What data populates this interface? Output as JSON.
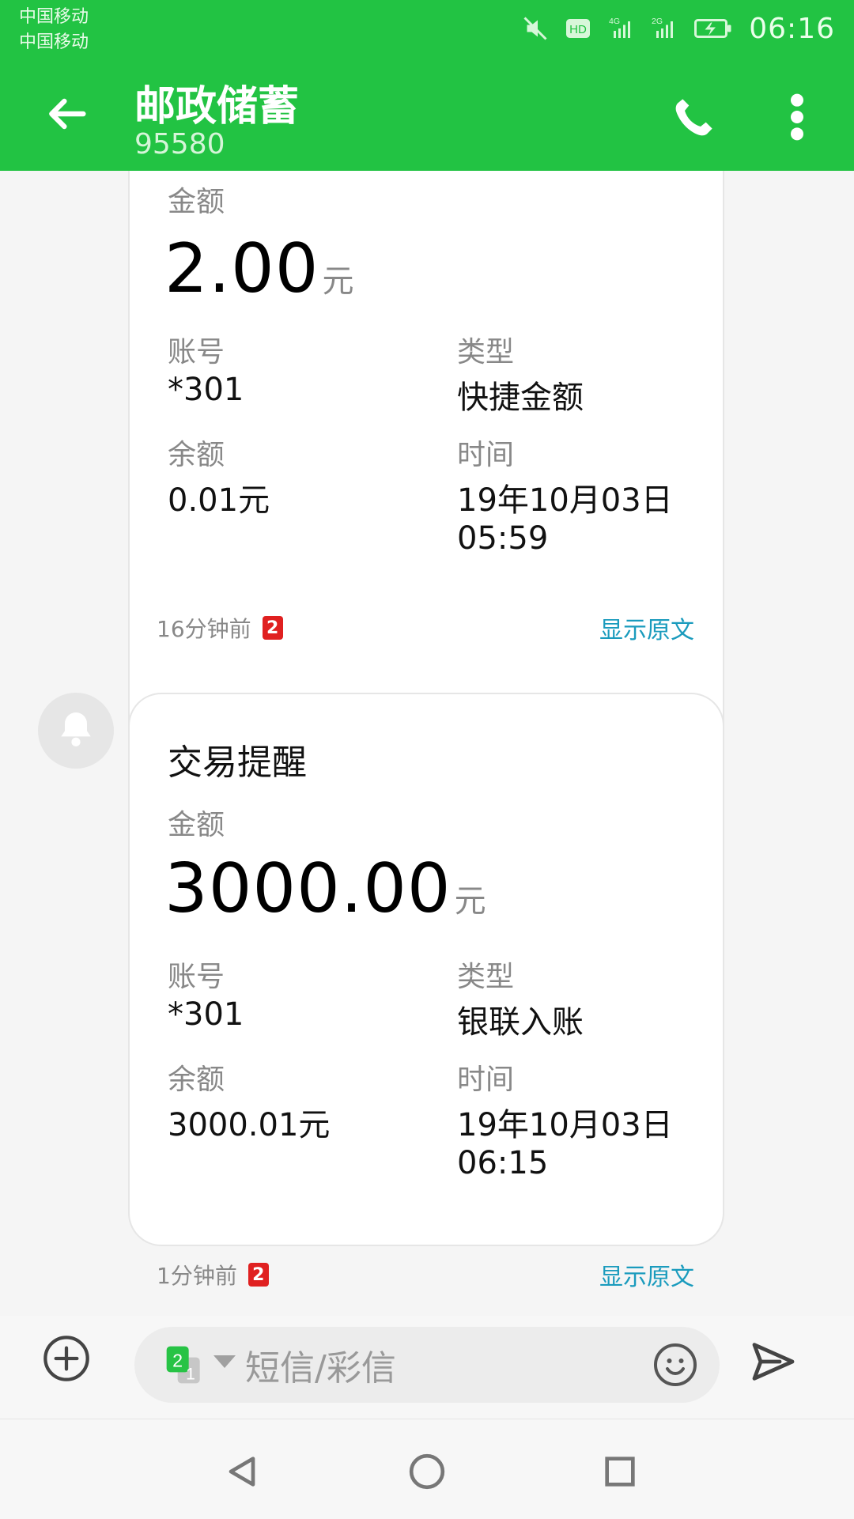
{
  "status": {
    "carrier1": "中国移动",
    "carrier2": "中国移动",
    "time": "06:16",
    "icons": [
      "mute-icon",
      "hd-icon",
      "signal-4g-icon",
      "signal-2g-icon",
      "battery-charging-icon"
    ]
  },
  "header": {
    "title": "邮政储蓄",
    "subtitle": "95580",
    "icons": {
      "back": "arrow-left-icon",
      "call": "phone-icon",
      "more": "more-vert-icon"
    }
  },
  "messages": [
    {
      "amount_label": "金额",
      "amount": "2.00",
      "amount_unit": "元",
      "account_label": "账号",
      "account": "*301",
      "type_label": "类型",
      "type": "快捷金额",
      "balance_label": "余额",
      "balance": "0.01元",
      "time_label": "时间",
      "time_line1": "19年10月03日",
      "time_line2": "05:59",
      "meta_time": "16分钟前",
      "sim_badge": "2",
      "show_raw": "显示原文"
    },
    {
      "title": "交易提醒",
      "amount_label": "金额",
      "amount": "3000.00",
      "amount_unit": "元",
      "account_label": "账号",
      "account": "*301",
      "type_label": "类型",
      "type": "银联入账",
      "balance_label": "余额",
      "balance": "3000.01元",
      "time_label": "时间",
      "time_line1": "19年10月03日",
      "time_line2": "06:15",
      "meta_time": "1分钟前",
      "sim_badge": "2",
      "show_raw": "显示原文"
    }
  ],
  "composer": {
    "placeholder": "短信/彩信",
    "sim_selected": "2",
    "sim_other": "1",
    "icons": {
      "add": "add-circle-icon",
      "emoji": "emoji-icon",
      "send": "send-icon"
    }
  },
  "navbar": {
    "icons": [
      "nav-back-icon",
      "nav-home-icon",
      "nav-recent-icon"
    ]
  },
  "colors": {
    "brand_green": "#22c343",
    "link_blue": "#1a9bbd",
    "badge_red": "#e02020"
  }
}
